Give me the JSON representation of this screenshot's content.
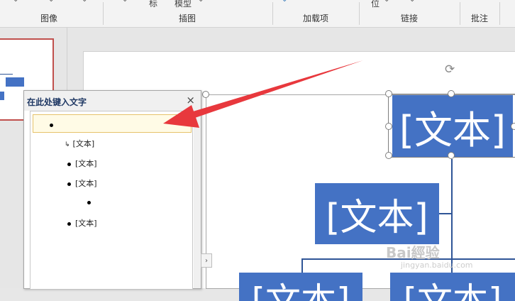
{
  "ribbon": {
    "groups": [
      {
        "label": "图像"
      },
      {
        "label": "插图",
        "fragments": [
          "标",
          "模型"
        ]
      },
      {
        "label": "加载项"
      },
      {
        "label": "链接",
        "fragments": [
          "位"
        ]
      },
      {
        "label": "批注"
      }
    ]
  },
  "text_pane": {
    "title": "在此处键入文字",
    "close_icon": "×",
    "items": [
      {
        "text": "",
        "level": 1,
        "marker": "bullet"
      },
      {
        "text": "[文本]",
        "level": 2,
        "marker": "arrow"
      },
      {
        "text": "[文本]",
        "level": 2,
        "marker": "bullet"
      },
      {
        "text": "[文本]",
        "level": 2,
        "marker": "bullet"
      },
      {
        "text": "",
        "level": 3,
        "marker": "bullet"
      },
      {
        "text": "[文本]",
        "level": 2,
        "marker": "bullet"
      }
    ]
  },
  "smartart": {
    "top_box": "[文本]",
    "middle_box": "[文本]",
    "bottom_left_box": "[文本]",
    "bottom_right_box": "[文本]"
  },
  "colors": {
    "box_fill": "#4472c4",
    "arrow": "#e8383d",
    "thumbnail_border": "#c0504d"
  },
  "watermark": {
    "text": "Bai經验",
    "sub": "jingyan.baidu.com"
  }
}
